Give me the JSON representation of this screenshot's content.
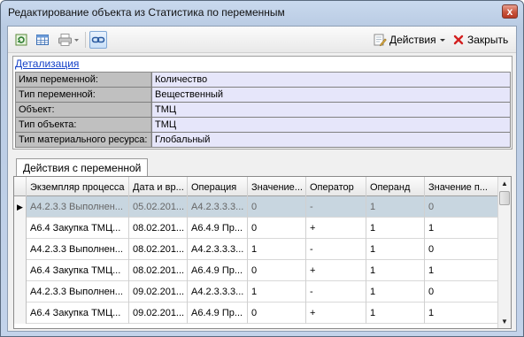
{
  "window": {
    "title": "Редактирование объекта  из Статистика по переменным",
    "close_glyph": "x"
  },
  "toolbar": {
    "icons": [
      "refresh-icon",
      "table-icon",
      "print-icon",
      "dropdown-arrow-icon",
      "link-icon"
    ],
    "actions_label": "Действия",
    "close_label": "Закрыть"
  },
  "details": {
    "link": "Детализация",
    "rows": [
      {
        "key": "Имя переменной:",
        "value": "Количество"
      },
      {
        "key": "Тип переменной:",
        "value": "Вещественный"
      },
      {
        "key": "Объект:",
        "value": "ТМЦ"
      },
      {
        "key": "Тип объекта:",
        "value": "ТМЦ"
      },
      {
        "key": "Тип материального ресурса:",
        "value": "Глобальный"
      }
    ]
  },
  "tab": {
    "label": "Действия с переменной"
  },
  "grid": {
    "columns": [
      "Экземпляр процесса",
      "Дата и вр...",
      "Операция",
      "Значение...",
      "Оператор",
      "Операнд",
      "Значение  п..."
    ],
    "current_row_marker": "▶",
    "rows": [
      [
        "А4.2.3.3 Выполнен...",
        "05.02.201...",
        "А4.2.3.3.3...",
        "0",
        "-",
        "1",
        "0"
      ],
      [
        "А6.4 Закупка ТМЦ...",
        "08.02.201...",
        "А6.4.9 Пр...",
        "0",
        "+",
        "1",
        "1"
      ],
      [
        "А4.2.3.3 Выполнен...",
        "08.02.201...",
        "А4.2.3.3.3...",
        "1",
        "-",
        "1",
        "0"
      ],
      [
        "А6.4 Закупка ТМЦ...",
        "08.02.201...",
        "А6.4.9 Пр...",
        "0",
        "+",
        "1",
        "1"
      ],
      [
        "А4.2.3.3 Выполнен...",
        "09.02.201...",
        "А4.2.3.3.3...",
        "1",
        "-",
        "1",
        "0"
      ],
      [
        "А6.4 Закупка ТМЦ...",
        "09.02.201...",
        "А6.4.9 Пр...",
        "0",
        "+",
        "1",
        "1"
      ]
    ],
    "selected_row": 0,
    "scroll_up_glyph": "▲",
    "scroll_down_glyph": "▼"
  }
}
